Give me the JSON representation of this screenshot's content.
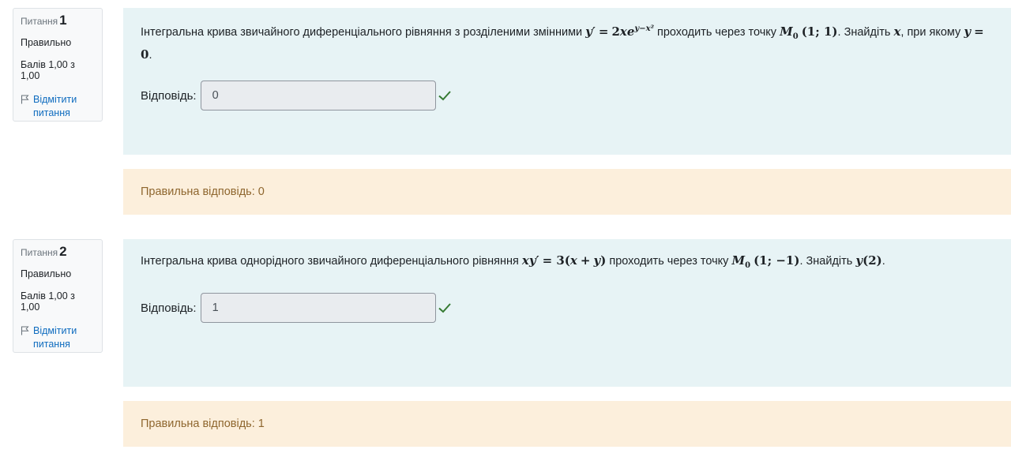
{
  "questions": [
    {
      "label": "Питання",
      "number": "1",
      "state": "Правильно",
      "grade": "Балів 1,00 з 1,00",
      "flag_line1": "Відмітити",
      "flag_line2": "питання",
      "text_before": "Інтегральна крива звичайного диференціального рівняння з розділеними змінними",
      "text_mid1": "проходить через точку",
      "text_mid2": ". Знайдіть",
      "text_mid3": ", при якому",
      "text_end": ".",
      "answer_label": "Відповідь:",
      "answer_value": "0",
      "correct_answer": "Правильна відповідь: 0"
    },
    {
      "label": "Питання",
      "number": "2",
      "state": "Правильно",
      "grade": "Балів 1,00 з 1,00",
      "flag_line1": "Відмітити",
      "flag_line2": "питання",
      "text_before": "Інтегральна крива однорідного звичайного диференціального рівняння",
      "text_mid1": "проходить через точку",
      "text_mid2": ". Знайдіть",
      "text_end": ".",
      "answer_label": "Відповідь:",
      "answer_value": "1",
      "correct_answer": "Правильна відповідь: 1"
    }
  ],
  "icons": {
    "flag": "flag-icon",
    "check": "check-icon"
  },
  "colors": {
    "content_bg": "#e7f3f5",
    "feedback_bg": "#fcefdc",
    "feedback_text": "#8e662e",
    "link": "#0f6cbf",
    "check": "#357a32"
  }
}
